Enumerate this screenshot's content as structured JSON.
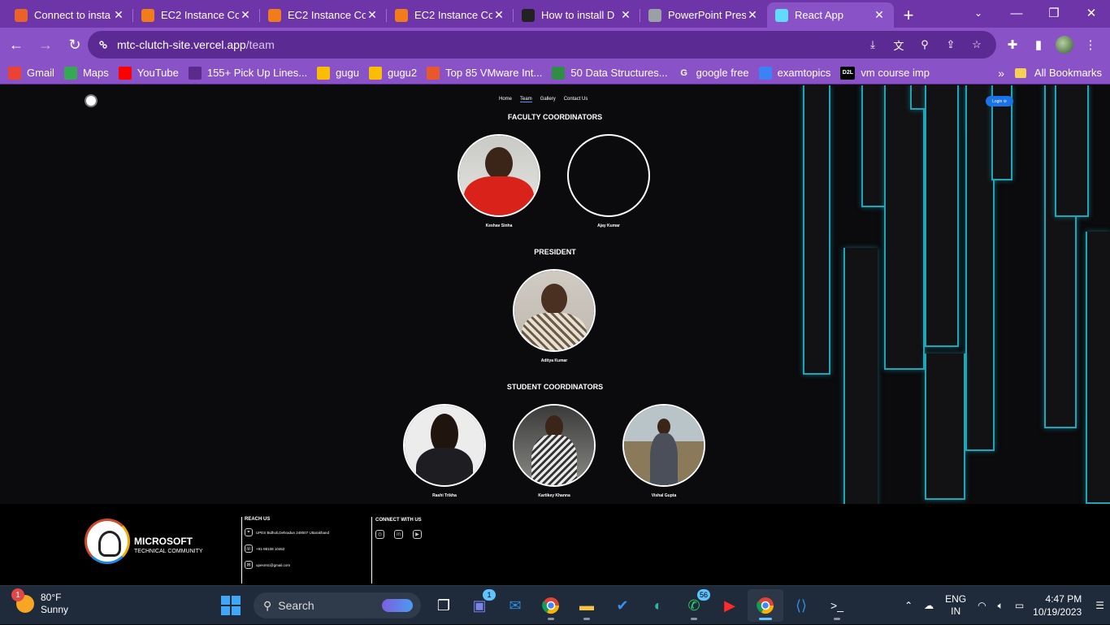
{
  "browser": {
    "tabs": [
      {
        "title": "Connect to insta",
        "icon": "aws-console-icon",
        "color": "#e8622a"
      },
      {
        "title": "EC2 Instance Co",
        "icon": "ec2-icon",
        "color": "#f07c1a"
      },
      {
        "title": "EC2 Instance Co",
        "icon": "ec2-icon",
        "color": "#f07c1a"
      },
      {
        "title": "EC2 Instance Co",
        "icon": "ec2-icon",
        "color": "#f07c1a"
      },
      {
        "title": "How to install D",
        "icon": "site-icon",
        "color": "#222222"
      },
      {
        "title": "PowerPoint Pres",
        "icon": "globe-icon",
        "color": "#9aa0a6"
      },
      {
        "title": "React App",
        "icon": "react-icon",
        "color": "#61dafb"
      }
    ],
    "url_domain": "mtc-clutch-site.vercel.app",
    "url_path": "/team",
    "bookmarks": [
      {
        "label": "Gmail",
        "icon": "gmail-icon"
      },
      {
        "label": "Maps",
        "icon": "maps-icon"
      },
      {
        "label": "YouTube",
        "icon": "youtube-icon"
      },
      {
        "label": "155+ Pick Up Lines...",
        "icon": "s-icon"
      },
      {
        "label": "gugu",
        "icon": "drive-icon"
      },
      {
        "label": "gugu2",
        "icon": "drive-icon"
      },
      {
        "label": "Top 85 VMware Int...",
        "icon": "diamond-icon"
      },
      {
        "label": "50 Data Structures...",
        "icon": "gfg-icon"
      },
      {
        "label": "google free",
        "icon": "google-icon"
      },
      {
        "label": "examtopics",
        "icon": "list-icon"
      },
      {
        "label": "vm course imp",
        "icon": "d2l-icon"
      }
    ],
    "bookmark_d2l_badge": "D2L",
    "all_bookmarks": "All Bookmarks",
    "more_chevron": "»"
  },
  "site": {
    "nav": [
      "Home",
      "Team",
      "Gallery",
      "Contact Us"
    ],
    "login": "Login",
    "sections": {
      "faculty": "FACULTY COORDINATORS",
      "president": "PRESIDENT",
      "students": "STUDENT COORDINATORS"
    },
    "faculty": [
      {
        "name": "Keshav Sinha"
      },
      {
        "name": "Ajay Kumar"
      }
    ],
    "president": [
      {
        "name": "Aditya Kumar"
      }
    ],
    "students": [
      {
        "name": "Rashi Trikha"
      },
      {
        "name": "Kartikey Khanna"
      },
      {
        "name": "Vishal Gupta"
      }
    ],
    "footer": {
      "brand": "MICROSOFT",
      "brand_sub": "TECHNICAL COMMUNITY",
      "reach_title": "REACH US",
      "address": "UPES Bidholi,Dehradun 248007 Uttarakhand",
      "phone": "+91-98108 10462",
      "email": "upesmtc@gmail.com",
      "connect_title": "CONNECT WITH US"
    },
    "accent_color": "#1ea6b8"
  },
  "taskbar": {
    "weather_temp": "80°F",
    "weather_desc": "Sunny",
    "weather_badge": "1",
    "search": "Search",
    "teams_badge": "1",
    "whatsapp_badge": "56",
    "lang": "ENG",
    "region": "IN",
    "time": "4:47 PM",
    "date": "10/19/2023"
  }
}
